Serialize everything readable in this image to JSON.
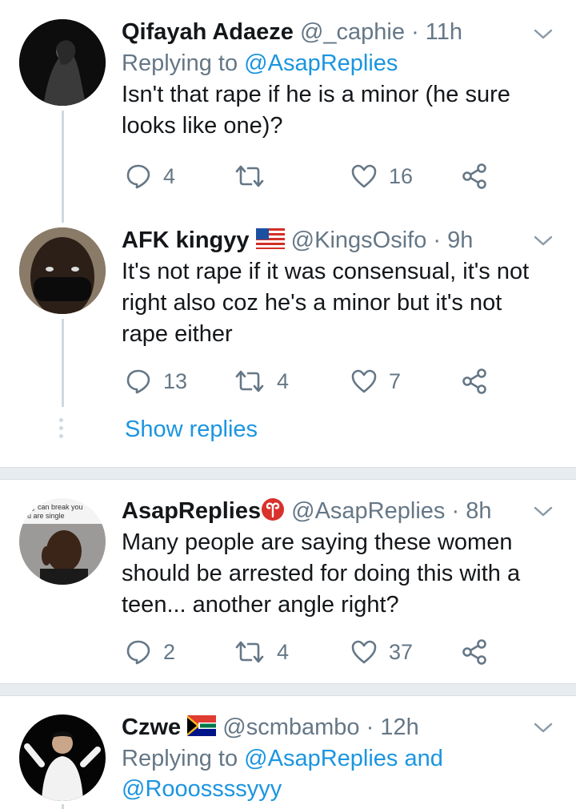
{
  "tweets": [
    {
      "name": "Qifayah Adaeze",
      "handle": "@_caphie",
      "time": "11h",
      "reply_prefix": "Replying to ",
      "reply_to": "@AsapReplies",
      "text_lines": [
        "Isn't that rape if he is a minor (he sure",
        "looks like one)?"
      ],
      "replies": "4",
      "retweets": "",
      "likes": "16"
    },
    {
      "name": "AFK kingyy",
      "flag": "us-flag",
      "handle": "@KingsOsifo",
      "time": "9h",
      "text_lines": [
        "It's not rape if it was consensual, it's not",
        "right also coz he's a minor but it's not",
        "rape either"
      ],
      "replies": "13",
      "retweets": "4",
      "likes": "7"
    },
    {
      "name": "AsapReplies",
      "badge": "aries-icon",
      "handle": "@AsapReplies",
      "time": "8h",
      "avatar_caption": [
        "y can break you",
        "u are single"
      ],
      "text_lines": [
        "Many people are saying these women",
        "should be arrested for doing this with a",
        "teen... another angle right?"
      ],
      "replies": "2",
      "retweets": "4",
      "likes": "37"
    },
    {
      "name": "Czwe",
      "flag": "za-flag",
      "handle": "@scmbambo",
      "time": "12h",
      "reply_prefix": "Replying to ",
      "reply_to": "@AsapReplies and",
      "reply_to_2": "@Rooossssyyy"
    }
  ],
  "show_replies": "Show replies",
  "separator_dot": "·",
  "colors": {
    "link": "#1b95e0",
    "muted": "#657786",
    "line": "#cfd9de",
    "separator": "#e6ecf0"
  }
}
